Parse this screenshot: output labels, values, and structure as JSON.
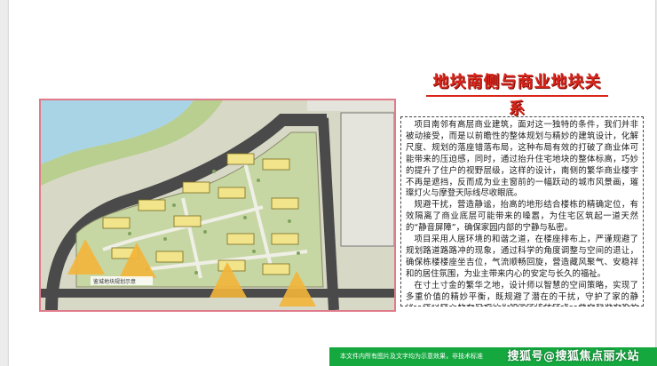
{
  "slide": {
    "title": "地块南侧与商业地块关系",
    "paragraphs": [
      "项目南邻有高层商业建筑，面对这一独特的条件，我们并非被动接受，而是以前瞻性的整体规划与精妙的建筑设计，化解尺度、规划的落座错落布局，这种布局有效的打破了商业体可能带来的压迫感，同时，通过抬升住宅地块的整体标高，巧妙的提升了住户的视野层级，这样的设计，南侧的繁华商业楼宇不再是遮挡，反而成为业主窗前的一幅跃动的城市风景画，璀璨灯火与摩登天际线尽收眼底。",
      "规避干扰，营造静谧，抬高的地形结合楼栋的精确定位，有效隔离了商业底层可能带来的噪嚣，为住宅区筑起一道天然的“静音屏障”，确保家园内部的宁静与私密。",
      "项目采用人居环境的和谐之道，在楼座排布上，严谨规避了规划路道路路冲的现象，通过科学的角度调整与空间的退让，确保栋楼楼座坐吉位，气流顺畅回旋，营造藏风聚气、安稳祥和的居住氛围，为业主带来内心的安定与长久的福祉。",
      "在寸土寸金的繁华之地，设计师以智慧的空间策略，实现了多重价值的精妙平衡，既规避了潜在的干扰，守护了家的静谧，更以匠心的布局巧妙化解了环境的顾虑，奠定和谐安稳的根基，这不仅是建筑的排布，更是对高品质都市生活的深刻理解，让业主在繁华深处坐拥一方视野开阔、气场和顺，动静皆宜的尊贵领地。"
    ],
    "plan_caption": "鉴城地块规划示意",
    "footer_notice": "本文件内所有图片及文字均为示意效果，非技术标准",
    "watermark": "搜狐号@搜狐焦点丽水站"
  },
  "colors": {
    "title": "#d9261c",
    "footer_bg": "#14a83f",
    "plan_border": "#e07b8b",
    "river": "#a9d4e6",
    "road": "#4a4a4a",
    "building": "#f2e48a",
    "green": "#b8cf8f",
    "sun_arrow": "#f3b53a"
  },
  "icons": [
    "sun-arrow-icon"
  ]
}
